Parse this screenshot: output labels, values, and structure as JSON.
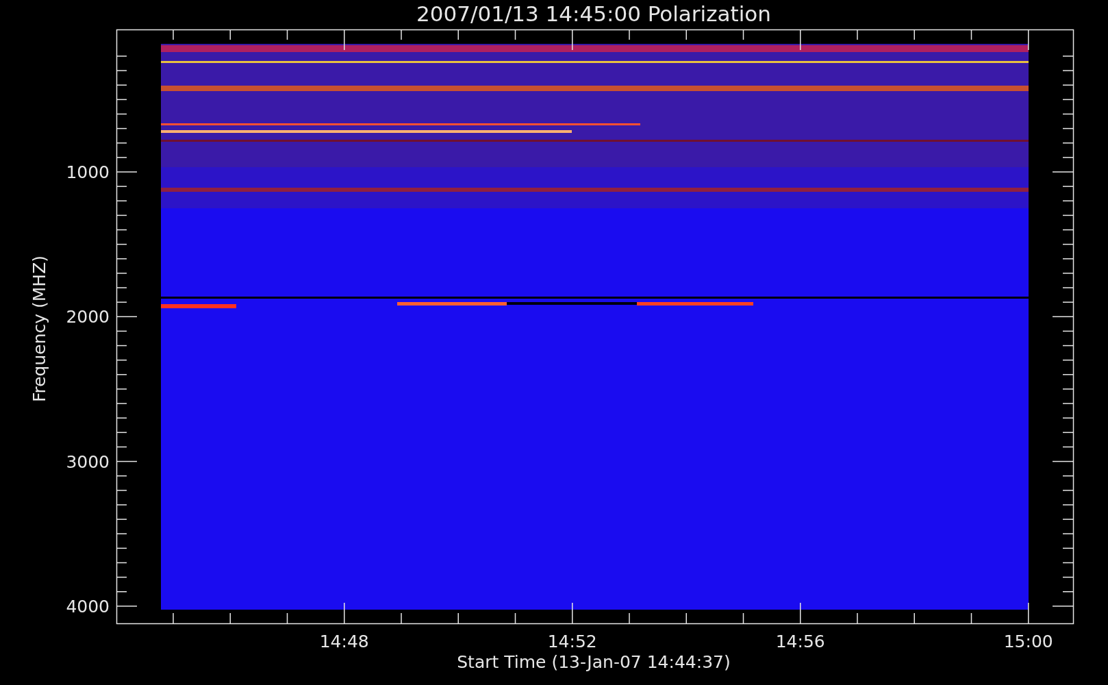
{
  "plot": {
    "title": "2007/01/13 14:45:00 Polarization",
    "ylabel": "Frequency (MHZ)",
    "xlabel": "Start Time (13-Jan-07 14:44:37)",
    "yticks": [
      "1000",
      "2000",
      "3000",
      "4000"
    ],
    "xticks": [
      "14:48",
      "14:52",
      "14:56",
      "15:00"
    ]
  }
}
